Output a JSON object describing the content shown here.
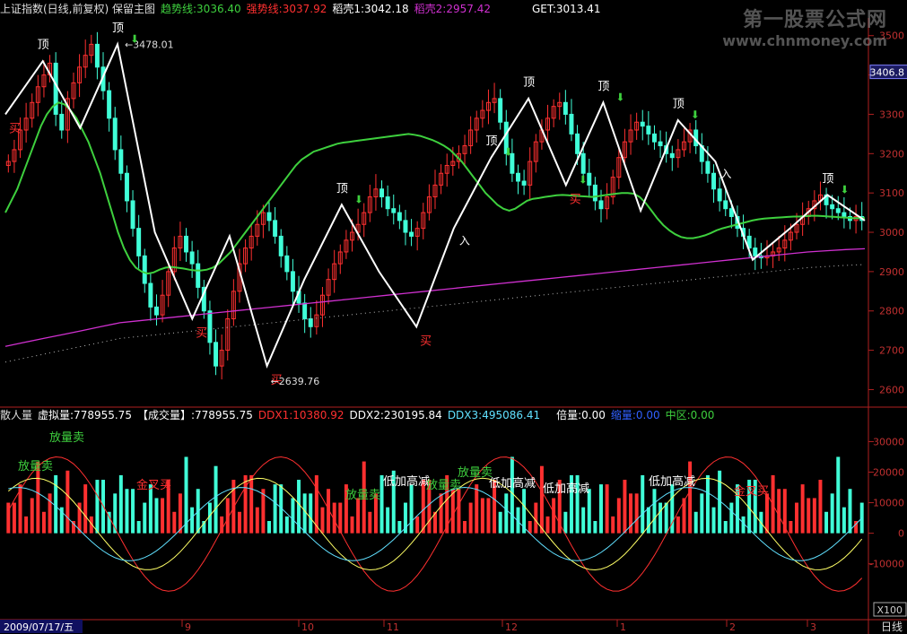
{
  "header": {
    "title": "上证指数(日线,前复权) 保留主图",
    "trend_label": "趋势线:3036.40",
    "strong_label": "强势线:3037.92",
    "shell1_label": "稻壳1:3042.18",
    "shell2_label": "稻壳2:2957.42",
    "get_label": "GET:3013.41"
  },
  "subheader": {
    "retail": "散人量",
    "virtual": "虚拟量:778955.75",
    "volume": "【成交量】:778955.75",
    "ddx1": "DDX1:10380.92",
    "ddx2": "DDX2:230195.84",
    "ddx3": "DDX3:495086.41",
    "ratio": "倍量:0.00",
    "shrink": "缩量:0.00",
    "mid": "中区:0.00"
  },
  "watermark": {
    "title": "第一股票公式网",
    "url": "www.chnmoney.com"
  },
  "colors": {
    "up": "#ff3030",
    "down": "#40ffd8",
    "green": "#3ed03e",
    "magenta": "#d030d0",
    "white": "#ffffff",
    "yellow": "#ffff66",
    "cyan": "#60e0ff",
    "axis": "#b02020",
    "buy_text": "#ff3030",
    "top_text": "#ffffff"
  },
  "chart_data": {
    "type": "candlestick",
    "price_axis": {
      "ticks": [
        2600,
        2700,
        2800,
        2900,
        3000,
        3100,
        3200,
        3300,
        3400,
        3500
      ],
      "range": [
        2560,
        3545
      ],
      "current_label": "3406.8"
    },
    "annotations": {
      "high": {
        "label": "3478.01",
        "value": 3478.01
      },
      "low": {
        "label": "2639.76",
        "value": 2639.76
      },
      "top": "顶",
      "buy": "买",
      "enter": "入"
    },
    "zigzag": [
      3300,
      3435,
      3265,
      3478,
      3000,
      2780,
      2990,
      2660,
      2880,
      3070,
      2900,
      2760,
      3010,
      3190,
      3340,
      3120,
      3330,
      3055,
      3285,
      3180,
      2930,
      3010,
      3095,
      3030
    ],
    "closes": [
      3180,
      3210,
      3260,
      3290,
      3330,
      3370,
      3400,
      3430,
      3300,
      3260,
      3340,
      3380,
      3420,
      3450,
      3478,
      3420,
      3360,
      3290,
      3210,
      3150,
      3080,
      3010,
      2940,
      2870,
      2810,
      2790,
      2840,
      2900,
      2960,
      2990,
      2950,
      2920,
      2860,
      2800,
      2720,
      2660,
      2700,
      2780,
      2850,
      2920,
      2960,
      2990,
      3020,
      3050,
      3030,
      2990,
      2940,
      2900,
      2850,
      2820,
      2780,
      2760,
      2790,
      2840,
      2880,
      2920,
      2950,
      2980,
      3000,
      3020,
      3050,
      3090,
      3110,
      3090,
      3060,
      3050,
      3030,
      3000,
      2990,
      3010,
      3050,
      3090,
      3120,
      3150,
      3170,
      3180,
      3200,
      3220,
      3260,
      3290,
      3310,
      3330,
      3340,
      3280,
      3200,
      3150,
      3130,
      3120,
      3180,
      3230,
      3260,
      3290,
      3320,
      3330,
      3300,
      3250,
      3200,
      3150,
      3120,
      3080,
      3060,
      3090,
      3140,
      3190,
      3230,
      3260,
      3280,
      3270,
      3250,
      3230,
      3220,
      3200,
      3190,
      3210,
      3230,
      3260,
      3220,
      3180,
      3150,
      3110,
      3080,
      3060,
      3040,
      3010,
      2990,
      2960,
      2940,
      2935,
      2940,
      2950,
      2960,
      2980,
      3000,
      3020,
      3040,
      3060,
      3080,
      3095,
      3070,
      3060,
      3050,
      3040,
      3030,
      3040,
      3030
    ],
    "ma_green": [
      3050,
      3080,
      3110,
      3150,
      3190,
      3230,
      3270,
      3300,
      3320,
      3330,
      3325,
      3310,
      3290,
      3260,
      3230,
      3190,
      3150,
      3100,
      3050,
      3000,
      2960,
      2930,
      2910,
      2900,
      2895,
      2898,
      2905,
      2910,
      2912,
      2910,
      2908,
      2905,
      2903,
      2903,
      2905,
      2910,
      2920,
      2935,
      2950,
      2970,
      2990,
      3010,
      3030,
      3050,
      3070,
      3090,
      3110,
      3130,
      3150,
      3170,
      3185,
      3195,
      3205,
      3210,
      3215,
      3220,
      3225,
      3228,
      3230,
      3232,
      3234,
      3236,
      3238,
      3240,
      3242,
      3244,
      3246,
      3248,
      3250,
      3248,
      3245,
      3240,
      3235,
      3228,
      3220,
      3210,
      3195,
      3180,
      3160,
      3140,
      3120,
      3100,
      3085,
      3070,
      3060,
      3055,
      3060,
      3070,
      3080,
      3085,
      3087,
      3090,
      3092,
      3094,
      3095,
      3094,
      3093,
      3092,
      3091,
      3090,
      3092,
      3094,
      3096,
      3098,
      3100,
      3100,
      3098,
      3090,
      3075,
      3055,
      3035,
      3018,
      3005,
      2995,
      2988,
      2985,
      2985,
      2988,
      2992,
      2998,
      3005,
      3010,
      3014,
      3018,
      3022,
      3026,
      3030,
      3033,
      3035,
      3036,
      3037,
      3038,
      3039,
      3040,
      3040,
      3041,
      3042,
      3042,
      3041,
      3040,
      3039,
      3038,
      3037,
      3036,
      3036,
      3036
    ],
    "ma_magenta": [
      2710,
      2720,
      2730,
      2740,
      2750,
      2760,
      2770,
      2775,
      2780,
      2785,
      2790,
      2795,
      2800,
      2805,
      2810,
      2815,
      2820,
      2825,
      2830,
      2835,
      2840,
      2845,
      2850,
      2855,
      2860,
      2865,
      2870,
      2875,
      2880,
      2885,
      2890,
      2895,
      2900,
      2905,
      2910,
      2915,
      2920,
      2925,
      2930,
      2935,
      2940,
      2945,
      2950,
      2953,
      2956,
      2958
    ],
    "volume_axis": {
      "ticks": [
        -10000,
        0,
        10000,
        20000,
        30000
      ],
      "range": [
        -28000,
        36000
      ],
      "unit": "X100"
    },
    "volume_annotations": [
      "放量卖",
      "放量卖",
      "金叉买",
      "放量卖",
      "低加高减",
      "放量卖",
      "放量卖",
      "低加高减",
      "低加高减",
      "低加高减",
      "金叉买"
    ],
    "x_axis": {
      "start_date": "2009/07/17/五",
      "month_ticks": [
        "9",
        "10",
        "11",
        "12",
        "1",
        "2",
        "3"
      ],
      "period": "日线"
    }
  }
}
